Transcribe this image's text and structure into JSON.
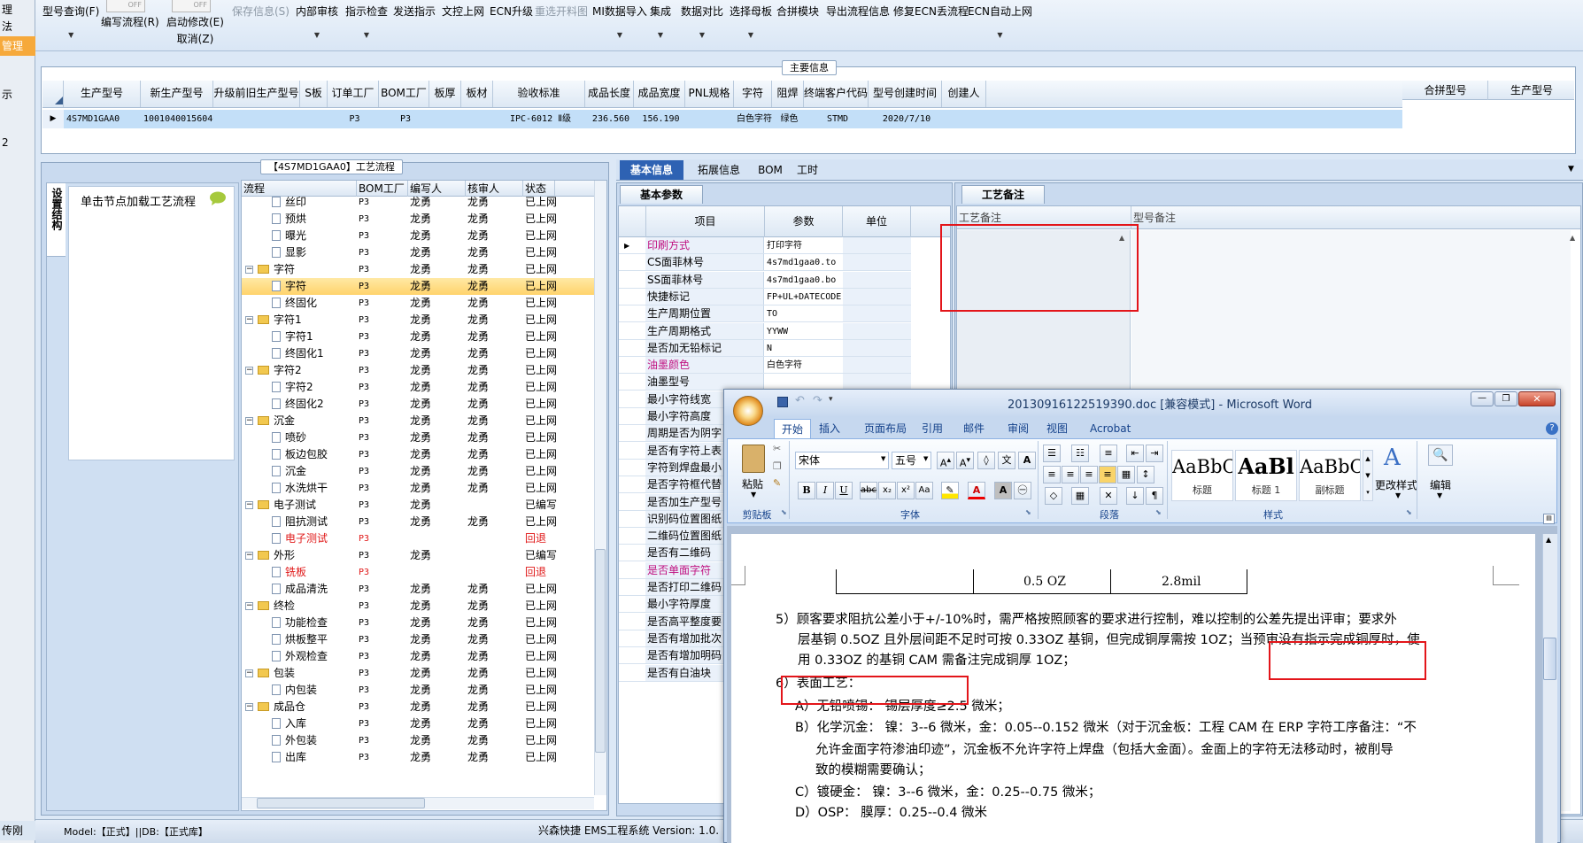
{
  "toolbar": {
    "buttons": [
      {
        "label": "型号查询(F)",
        "has_dropdown": true,
        "disabled": false
      },
      {
        "label": "编写流程(R)",
        "has_dropdown": false,
        "disabled": false
      },
      {
        "label": "启动修改(E)",
        "label2": "取消(Z)",
        "has_dropdown": false,
        "disabled": false
      },
      {
        "label": "保存信息(S)",
        "has_dropdown": false,
        "disabled": true
      },
      {
        "label": "内部审核",
        "has_dropdown": true,
        "disabled": false
      },
      {
        "label": "指示检查",
        "has_dropdown": true,
        "disabled": false
      },
      {
        "label": "发送指示",
        "has_dropdown": false,
        "disabled": false
      },
      {
        "label": "文控上网",
        "has_dropdown": false,
        "disabled": false
      },
      {
        "label": "ECN升级",
        "has_dropdown": false,
        "disabled": false
      },
      {
        "label": "重选开料图",
        "has_dropdown": false,
        "disabled": true
      },
      {
        "label": "MI数据导入",
        "has_dropdown": true,
        "disabled": false
      },
      {
        "label": "集成",
        "has_dropdown": true,
        "disabled": false
      },
      {
        "label": "数据对比",
        "has_dropdown": true,
        "disabled": false
      },
      {
        "label": "选择母板",
        "has_dropdown": true,
        "disabled": false
      },
      {
        "label": "合拼模块",
        "has_dropdown": false,
        "disabled": false
      },
      {
        "label": "导出流程信息",
        "has_dropdown": false,
        "disabled": false
      },
      {
        "label": "修复ECN丢流程",
        "has_dropdown": false,
        "disabled": false
      },
      {
        "label": "ECN自动上网",
        "has_dropdown": true,
        "disabled": false
      }
    ],
    "toggle_off": "OFF"
  },
  "left_strip": {
    "items": [
      "理",
      "法",
      "管理",
      "示",
      "2"
    ],
    "user": "传刚"
  },
  "main_info": {
    "title": "主要信息",
    "columns": [
      "生产型号",
      "新生产型号",
      "升级前旧生产型号",
      "S板",
      "订单工厂",
      "BOM工厂",
      "板厚",
      "板材",
      "验收标准",
      "成品长度",
      "成品宽度",
      "PNL规格",
      "字符",
      "阻焊",
      "终端客户代码",
      "型号创建时间",
      "创建人"
    ],
    "row": [
      "4S7MD1GAA0",
      "10010400156040",
      "",
      "",
      "P3",
      "P3",
      "",
      "",
      "IPC-6012 Ⅱ级",
      "236.560",
      "156.190",
      "",
      "白色字符",
      "绿色",
      "STMD",
      "2020/7/10",
      ""
    ],
    "side_columns": [
      "合拼型号",
      "生产型号"
    ]
  },
  "process_panel": {
    "title": "【4S7MD1GAA0】工艺流程",
    "vertical_tab": "设置结构",
    "hint": "单击节点加载工艺流程",
    "columns": [
      "流程",
      "BOM工厂",
      "编写人",
      "核审人",
      "状态"
    ],
    "rows": [
      {
        "name": "丝印",
        "level": 2,
        "type": "file",
        "bom": "P3",
        "writer": "龙勇",
        "reviewer": "龙勇",
        "status": "已上网",
        "red": false,
        "hl": false
      },
      {
        "name": "预烘",
        "level": 2,
        "type": "file",
        "bom": "P3",
        "writer": "龙勇",
        "reviewer": "龙勇",
        "status": "已上网",
        "red": false,
        "hl": false
      },
      {
        "name": "曝光",
        "level": 2,
        "type": "file",
        "bom": "P3",
        "writer": "龙勇",
        "reviewer": "龙勇",
        "status": "已上网",
        "red": false,
        "hl": false
      },
      {
        "name": "显影",
        "level": 2,
        "type": "file",
        "bom": "P3",
        "writer": "龙勇",
        "reviewer": "龙勇",
        "status": "已上网",
        "red": false,
        "hl": false
      },
      {
        "name": "字符",
        "level": 1,
        "type": "folder",
        "bom": "P3",
        "writer": "龙勇",
        "reviewer": "龙勇",
        "status": "已上网",
        "red": false,
        "hl": false
      },
      {
        "name": "字符",
        "level": 2,
        "type": "file",
        "bom": "P3",
        "writer": "龙勇",
        "reviewer": "龙勇",
        "status": "已上网",
        "red": false,
        "hl": true
      },
      {
        "name": "终固化",
        "level": 2,
        "type": "file",
        "bom": "P3",
        "writer": "龙勇",
        "reviewer": "龙勇",
        "status": "已上网",
        "red": false,
        "hl": false
      },
      {
        "name": "字符1",
        "level": 1,
        "type": "folder",
        "bom": "P3",
        "writer": "龙勇",
        "reviewer": "龙勇",
        "status": "已上网",
        "red": false,
        "hl": false
      },
      {
        "name": "字符1",
        "level": 2,
        "type": "file",
        "bom": "P3",
        "writer": "龙勇",
        "reviewer": "龙勇",
        "status": "已上网",
        "red": false,
        "hl": false
      },
      {
        "name": "终固化1",
        "level": 2,
        "type": "file",
        "bom": "P3",
        "writer": "龙勇",
        "reviewer": "龙勇",
        "status": "已上网",
        "red": false,
        "hl": false
      },
      {
        "name": "字符2",
        "level": 1,
        "type": "folder",
        "bom": "P3",
        "writer": "龙勇",
        "reviewer": "龙勇",
        "status": "已上网",
        "red": false,
        "hl": false
      },
      {
        "name": "字符2",
        "level": 2,
        "type": "file",
        "bom": "P3",
        "writer": "龙勇",
        "reviewer": "龙勇",
        "status": "已上网",
        "red": false,
        "hl": false
      },
      {
        "name": "终固化2",
        "level": 2,
        "type": "file",
        "bom": "P3",
        "writer": "龙勇",
        "reviewer": "龙勇",
        "status": "已上网",
        "red": false,
        "hl": false
      },
      {
        "name": "沉金",
        "level": 1,
        "type": "folder",
        "bom": "P3",
        "writer": "龙勇",
        "reviewer": "龙勇",
        "status": "已上网",
        "red": false,
        "hl": false
      },
      {
        "name": "喷砂",
        "level": 2,
        "type": "file",
        "bom": "P3",
        "writer": "龙勇",
        "reviewer": "龙勇",
        "status": "已上网",
        "red": false,
        "hl": false
      },
      {
        "name": "板边包胶",
        "level": 2,
        "type": "file",
        "bom": "P3",
        "writer": "龙勇",
        "reviewer": "龙勇",
        "status": "已上网",
        "red": false,
        "hl": false
      },
      {
        "name": "沉金",
        "level": 2,
        "type": "file",
        "bom": "P3",
        "writer": "龙勇",
        "reviewer": "龙勇",
        "status": "已上网",
        "red": false,
        "hl": false
      },
      {
        "name": "水洗烘干",
        "level": 2,
        "type": "file",
        "bom": "P3",
        "writer": "龙勇",
        "reviewer": "龙勇",
        "status": "已上网",
        "red": false,
        "hl": false
      },
      {
        "name": "电子测试",
        "level": 1,
        "type": "folder",
        "bom": "P3",
        "writer": "龙勇",
        "reviewer": "",
        "status": "已编写",
        "red": false,
        "hl": false
      },
      {
        "name": "阻抗测试",
        "level": 2,
        "type": "file",
        "bom": "P3",
        "writer": "龙勇",
        "reviewer": "龙勇",
        "status": "已上网",
        "red": false,
        "hl": false
      },
      {
        "name": "电子测试",
        "level": 2,
        "type": "file",
        "bom": "P3",
        "writer": "",
        "reviewer": "",
        "status": "回退",
        "red": true,
        "hl": false
      },
      {
        "name": "外形",
        "level": 1,
        "type": "folder",
        "bom": "P3",
        "writer": "龙勇",
        "reviewer": "",
        "status": "已编写",
        "red": false,
        "hl": false
      },
      {
        "name": "铣板",
        "level": 2,
        "type": "file",
        "bom": "P3",
        "writer": "",
        "reviewer": "",
        "status": "回退",
        "red": true,
        "hl": false
      },
      {
        "name": "成品清洗",
        "level": 2,
        "type": "file",
        "bom": "P3",
        "writer": "龙勇",
        "reviewer": "龙勇",
        "status": "已上网",
        "red": false,
        "hl": false
      },
      {
        "name": "终检",
        "level": 1,
        "type": "folder",
        "bom": "P3",
        "writer": "龙勇",
        "reviewer": "龙勇",
        "status": "已上网",
        "red": false,
        "hl": false
      },
      {
        "name": "功能检查",
        "level": 2,
        "type": "file",
        "bom": "P3",
        "writer": "龙勇",
        "reviewer": "龙勇",
        "status": "已上网",
        "red": false,
        "hl": false
      },
      {
        "name": "烘板整平",
        "level": 2,
        "type": "file",
        "bom": "P3",
        "writer": "龙勇",
        "reviewer": "龙勇",
        "status": "已上网",
        "red": false,
        "hl": false
      },
      {
        "name": "外观检查",
        "level": 2,
        "type": "file",
        "bom": "P3",
        "writer": "龙勇",
        "reviewer": "龙勇",
        "status": "已上网",
        "red": false,
        "hl": false
      },
      {
        "name": "包装",
        "level": 1,
        "type": "folder",
        "bom": "P3",
        "writer": "龙勇",
        "reviewer": "龙勇",
        "status": "已上网",
        "red": false,
        "hl": false
      },
      {
        "name": "内包装",
        "level": 2,
        "type": "file",
        "bom": "P3",
        "writer": "龙勇",
        "reviewer": "龙勇",
        "status": "已上网",
        "red": false,
        "hl": false
      },
      {
        "name": "成品仓",
        "level": 1,
        "type": "folder",
        "bom": "P3",
        "writer": "龙勇",
        "reviewer": "龙勇",
        "status": "已上网",
        "red": false,
        "hl": false
      },
      {
        "name": "入库",
        "level": 2,
        "type": "file",
        "bom": "P3",
        "writer": "龙勇",
        "reviewer": "龙勇",
        "status": "已上网",
        "red": false,
        "hl": false
      },
      {
        "name": "外包装",
        "level": 2,
        "type": "file",
        "bom": "P3",
        "writer": "龙勇",
        "reviewer": "龙勇",
        "status": "已上网",
        "red": false,
        "hl": false
      },
      {
        "name": "出库",
        "level": 2,
        "type": "file",
        "bom": "P3",
        "writer": "龙勇",
        "reviewer": "龙勇",
        "status": "已上网",
        "red": false,
        "hl": false
      }
    ]
  },
  "detail_tabs": [
    "基本信息",
    "拓展信息",
    "BOM",
    "工时"
  ],
  "basic_params": {
    "title": "基本参数",
    "columns": [
      "项目",
      "参数",
      "单位"
    ],
    "rows": [
      {
        "k": "印刷方式",
        "v": "打印字符",
        "pink": true
      },
      {
        "k": "CS面菲林号",
        "v": "4s7md1gaa0.to",
        "pink": false
      },
      {
        "k": "SS面菲林号",
        "v": "4s7md1gaa0.bo",
        "pink": false
      },
      {
        "k": "快捷标记",
        "v": "FP+UL+DATECODE",
        "pink": false
      },
      {
        "k": "生产周期位置",
        "v": "TO",
        "pink": false
      },
      {
        "k": "生产周期格式",
        "v": "YYWW",
        "pink": false
      },
      {
        "k": "是否加无铅标记",
        "v": "N",
        "pink": false
      },
      {
        "k": "油墨颜色",
        "v": "白色字符",
        "pink": true
      },
      {
        "k": "油墨型号",
        "v": "",
        "pink": false
      },
      {
        "k": "最小字符线宽",
        "v": "",
        "pink": false
      },
      {
        "k": "最小字符高度",
        "v": "",
        "pink": false
      },
      {
        "k": "周期是否为阴字",
        "v": "",
        "pink": false
      },
      {
        "k": "是否有字符上表",
        "v": "",
        "pink": false
      },
      {
        "k": "字符到焊盘最小",
        "v": "",
        "pink": false
      },
      {
        "k": "是否字符框代替",
        "v": "",
        "pink": false
      },
      {
        "k": "是否加生产型号",
        "v": "",
        "pink": false
      },
      {
        "k": "识别码位置图纸",
        "v": "",
        "pink": false
      },
      {
        "k": "二维码位置图纸",
        "v": "",
        "pink": false
      },
      {
        "k": "是否有二维码",
        "v": "",
        "pink": false
      },
      {
        "k": "是否单面字符",
        "v": "",
        "pink": true
      },
      {
        "k": "是否打印二维码",
        "v": "",
        "pink": false
      },
      {
        "k": "最小字符厚度",
        "v": "",
        "pink": false
      },
      {
        "k": "是否高平整度要",
        "v": "",
        "pink": false
      },
      {
        "k": "是否有增加批次",
        "v": "",
        "pink": false
      },
      {
        "k": "是否有增加明码",
        "v": "",
        "pink": false
      },
      {
        "k": "是否有白油块",
        "v": "",
        "pink": false
      }
    ]
  },
  "remarks": {
    "tab": "工艺备注",
    "col1": "工艺备注",
    "col2": "型号备注"
  },
  "status_bar": {
    "model": "Model:【正式】||DB:【正式库】",
    "app": "兴森快捷 EMS工程系统 Version: 1.0."
  },
  "word": {
    "title": "20130916122519390.doc [兼容模式] - Microsoft Word",
    "tabs": [
      "开始",
      "插入",
      "页面布局",
      "引用",
      "邮件",
      "审阅",
      "视图",
      "Acrobat"
    ],
    "paste": "粘贴",
    "font_name": "宋体",
    "font_size": "五号",
    "groups": [
      "剪贴板",
      "字体",
      "段落",
      "样式",
      "编辑"
    ],
    "styles": [
      {
        "sample": "AaBbC",
        "name": "标题"
      },
      {
        "sample": "AaBl",
        "name": "标题 1"
      },
      {
        "sample": "AaBbC",
        "name": "副标题"
      }
    ],
    "change_styles": "更改样式",
    "edit": "编辑",
    "table_cells": [
      "0.5 OZ",
      "2.8mil"
    ],
    "lines": [
      "5）顾客要求阻抗公差小于+/-10%时，需严格按照顾客的要求进行控制，难以控制的公差先提出评审；要求外",
      "层基铜 0.5OZ 且外层间距不足时可按 0.33OZ 基铜，但完成铜厚需按 1OZ；当预审没有指示完成铜厚时，使",
      "用 0.33OZ 的基铜 CAM 需备注完成铜厚 1OZ；",
      "6）表面工艺：",
      "A）无铅喷锡：  锡层厚度≥2.5 微米；",
      "B）化学沉金：  镍：3--6 微米，金：0.05--0.152 微米（对于沉金板：工程 CAM 在 ERP 字符工序备注：“不",
      "允许金面字符渗油印迹”，沉金板不允许字符上焊盘（包括大金面）。金面上的字符无法移动时，被削导",
      "致的模糊需要确认；",
      "C）镀硬金：    镍：3--6 微米，金：0.25--0.75 微米；",
      "D）OSP：       膜厚：0.25--0.4 微米"
    ]
  }
}
